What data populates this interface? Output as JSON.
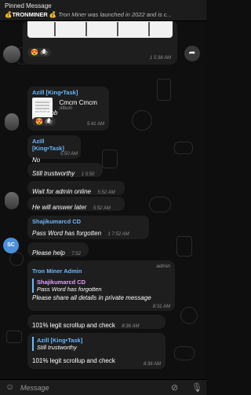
{
  "pinned": {
    "title": "Pinned Message",
    "prefix": "💰TRONMINER 💰",
    "text": " Tron Miner was launched in 2022 and is c..."
  },
  "messages": {
    "first": {
      "reactions": "😍 🕷",
      "time": "1 5:38 AM"
    },
    "album": {
      "sender": "Azill [King•Task]",
      "album_title": "Cmcm Cmcm",
      "album_label": "Album",
      "text": "Good job",
      "reactions": "😍 🕷",
      "time": "5:41 AM"
    },
    "no_msg": {
      "sender": "Azill [King•Task]",
      "text": "No",
      "time": "5:50 AM"
    },
    "trust": {
      "text": "Still trustworthy",
      "time": "1 5:50 AM"
    },
    "wait": {
      "text": "Wait for admin online",
      "time": "5:52 AM"
    },
    "later": {
      "text": "He will answer later",
      "time": "5:52 AM"
    },
    "shaji": {
      "sender": "Shajikumarcd CD",
      "avatar_initials": "SC",
      "text": "Pass Word has forgotten",
      "time": "1 7:52 AM"
    },
    "help": {
      "text": "Please help",
      "time": "7:52 AM"
    },
    "admin": {
      "sender": "Tron Miner Admin",
      "role": "admin",
      "quote_name": "Shajikumarcd CD",
      "quote_text": "Pass Word has forgotten",
      "text": "Please share all details in private message",
      "time": "8:31 AM"
    },
    "scroll1": {
      "text": "101% legit scrollup and check",
      "time": "8:36 AM"
    },
    "scroll2": {
      "quote_name": "Azill [King•Task]",
      "quote_text": "Still trustworthy",
      "text": "101% legit scrollup and check",
      "time": "8:36 AM"
    }
  },
  "input": {
    "placeholder": "Message"
  },
  "icons": {
    "forward": "share-forward-icon",
    "emoji": "emoji-icon",
    "attach": "paperclip-icon",
    "mic": "microphone-icon"
  }
}
